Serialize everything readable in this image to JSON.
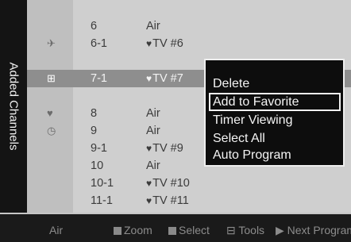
{
  "sidebar": {
    "title": "Added Channels"
  },
  "channels": [
    {
      "number": "6",
      "name": "Air",
      "favorite": false,
      "icon": ""
    },
    {
      "number": "6-1",
      "name": "TV #6",
      "favorite": true,
      "icon": "lock"
    },
    {
      "number": "7-1",
      "name": "TV #7",
      "favorite": true,
      "icon": "add",
      "selected": true
    },
    {
      "number": "8",
      "name": "Air",
      "favorite": false,
      "icon": "heart"
    },
    {
      "number": "9",
      "name": "Air",
      "favorite": false,
      "icon": "clock"
    },
    {
      "number": "9-1",
      "name": "TV #9",
      "favorite": true,
      "icon": ""
    },
    {
      "number": "10",
      "name": "Air",
      "favorite": false,
      "icon": ""
    },
    {
      "number": "10-1",
      "name": "TV #10",
      "favorite": true,
      "icon": ""
    },
    {
      "number": "11-1",
      "name": "TV #11",
      "favorite": true,
      "icon": ""
    }
  ],
  "tools_menu": {
    "items": [
      "Delete",
      "Add to Favorite",
      "Timer Viewing",
      "Select All",
      "Auto Program"
    ],
    "focused": "Add to Favorite"
  },
  "footer": {
    "source": "Air",
    "zoom": "Zoom",
    "select": "Select",
    "tools": "Tools",
    "next": "Next Program"
  }
}
